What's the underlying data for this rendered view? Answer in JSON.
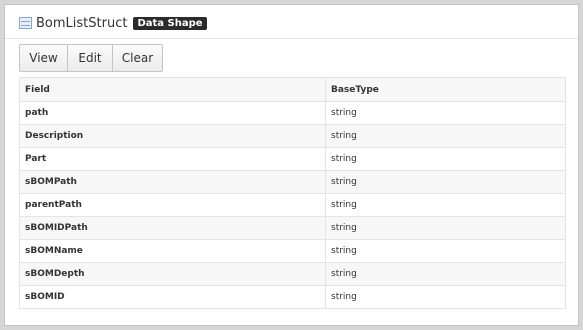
{
  "header": {
    "title": "BomListStruct",
    "badge": "Data Shape"
  },
  "toolbar": {
    "view_label": "View",
    "edit_label": "Edit",
    "clear_label": "Clear"
  },
  "grid": {
    "columns": [
      "Field",
      "BaseType"
    ],
    "rows": [
      {
        "field": "path",
        "type": "string"
      },
      {
        "field": "Description",
        "type": "string"
      },
      {
        "field": "Part",
        "type": "string"
      },
      {
        "field": "sBOMPath",
        "type": "string"
      },
      {
        "field": "parentPath",
        "type": "string"
      },
      {
        "field": "sBOMIDPath",
        "type": "string"
      },
      {
        "field": "sBOMName",
        "type": "string"
      },
      {
        "field": "sBOMDepth",
        "type": "string"
      },
      {
        "field": "sBOMID",
        "type": "string"
      }
    ]
  }
}
